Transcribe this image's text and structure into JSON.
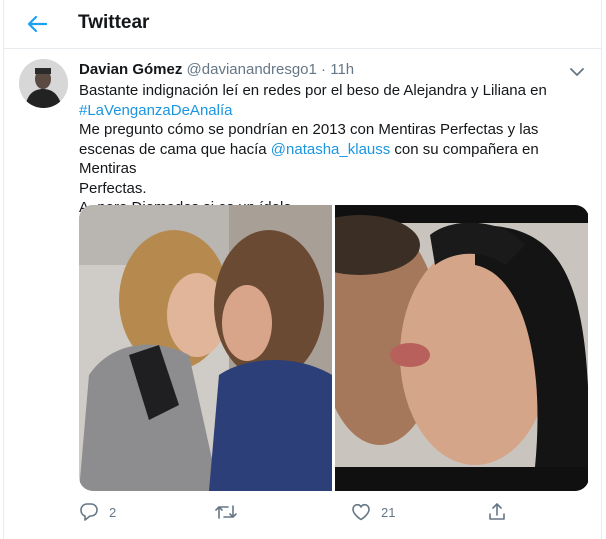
{
  "header": {
    "title": "Twittear",
    "back_icon": "arrow-left-icon"
  },
  "colors": {
    "accent": "#1da1f2",
    "link": "#1b95e0",
    "muted": "#657786",
    "text": "#14171a",
    "border": "#e6ecf0"
  },
  "tweet": {
    "author_name": "Davian Gómez",
    "handle": "@davianandresgo1",
    "separator": "·",
    "time": "11h",
    "text": {
      "line1": "Bastante indignación leí en redes por el beso de Alejandra y Liliana en",
      "hashtag": "#LaVenganzaDeAnalía",
      "line3": "Me pregunto cómo se pondrían en 2013 con Mentiras Perfectas y las",
      "line4_before": "escenas de cama que hacía ",
      "mention": "@natasha_klauss",
      "line4_after": " con su compañera en Mentiras",
      "line5": "Perfectas.",
      "line6": "A, pero Diomedes si es un ídolo."
    },
    "media_count": 2
  },
  "actions": {
    "reply_count": "2",
    "retweet_count": "",
    "like_count": "21"
  }
}
